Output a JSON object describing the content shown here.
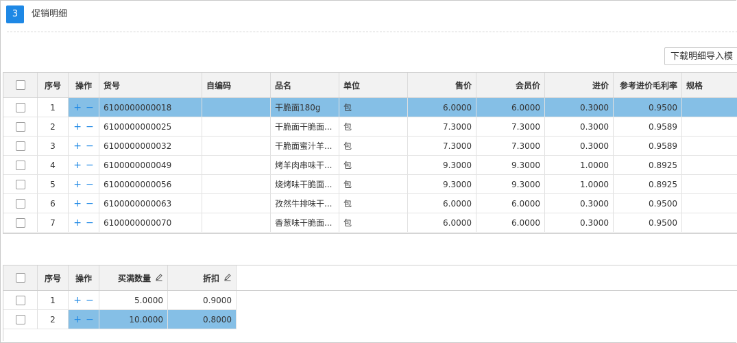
{
  "section": {
    "step": "3",
    "title": "促销明细"
  },
  "toolbar": {
    "download_label": "下载明细导入模"
  },
  "detail_table": {
    "columns": [
      "序号",
      "操作",
      "货号",
      "自编码",
      "品名",
      "单位",
      "售价",
      "会员价",
      "进价",
      "参考进价毛利率",
      "规格"
    ],
    "ops": {
      "add": "+",
      "remove": "−"
    },
    "rows": [
      {
        "seq": "1",
        "code": "6100000000018",
        "selfcode": "",
        "name": "干脆面180g",
        "unit": "包",
        "price": "6.0000",
        "member_price": "6.0000",
        "cost": "0.3000",
        "margin": "0.9500",
        "spec": "",
        "selected": true
      },
      {
        "seq": "2",
        "code": "6100000000025",
        "selfcode": "",
        "name": "干脆面干脆面...",
        "unit": "包",
        "price": "7.3000",
        "member_price": "7.3000",
        "cost": "0.3000",
        "margin": "0.9589",
        "spec": "",
        "selected": false
      },
      {
        "seq": "3",
        "code": "6100000000032",
        "selfcode": "",
        "name": "干脆面蜜汁羊...",
        "unit": "包",
        "price": "7.3000",
        "member_price": "7.3000",
        "cost": "0.3000",
        "margin": "0.9589",
        "spec": "",
        "selected": false
      },
      {
        "seq": "4",
        "code": "6100000000049",
        "selfcode": "",
        "name": "烤羊肉串味干...",
        "unit": "包",
        "price": "9.3000",
        "member_price": "9.3000",
        "cost": "1.0000",
        "margin": "0.8925",
        "spec": "",
        "selected": false
      },
      {
        "seq": "5",
        "code": "6100000000056",
        "selfcode": "",
        "name": "烧烤味干脆面...",
        "unit": "包",
        "price": "9.3000",
        "member_price": "9.3000",
        "cost": "1.0000",
        "margin": "0.8925",
        "spec": "",
        "selected": false
      },
      {
        "seq": "6",
        "code": "6100000000063",
        "selfcode": "",
        "name": "孜然牛排味干...",
        "unit": "包",
        "price": "6.0000",
        "member_price": "6.0000",
        "cost": "0.3000",
        "margin": "0.9500",
        "spec": "",
        "selected": false
      },
      {
        "seq": "7",
        "code": "6100000000070",
        "selfcode": "",
        "name": "香葱味干脆面...",
        "unit": "包",
        "price": "6.0000",
        "member_price": "6.0000",
        "cost": "0.3000",
        "margin": "0.9500",
        "spec": "",
        "selected": false
      }
    ]
  },
  "discount_table": {
    "columns": [
      "序号",
      "操作",
      "买满数量",
      "折扣"
    ],
    "ops": {
      "add": "+",
      "remove": "−"
    },
    "rows": [
      {
        "seq": "1",
        "qty": "5.0000",
        "discount": "0.9000",
        "selected": false
      },
      {
        "seq": "2",
        "qty": "10.0000",
        "discount": "0.8000",
        "selected": true
      }
    ]
  },
  "colors": {
    "accent": "#1e88e5",
    "selected_row": "#85bfe6",
    "header_bg": "#f2f2f2"
  }
}
